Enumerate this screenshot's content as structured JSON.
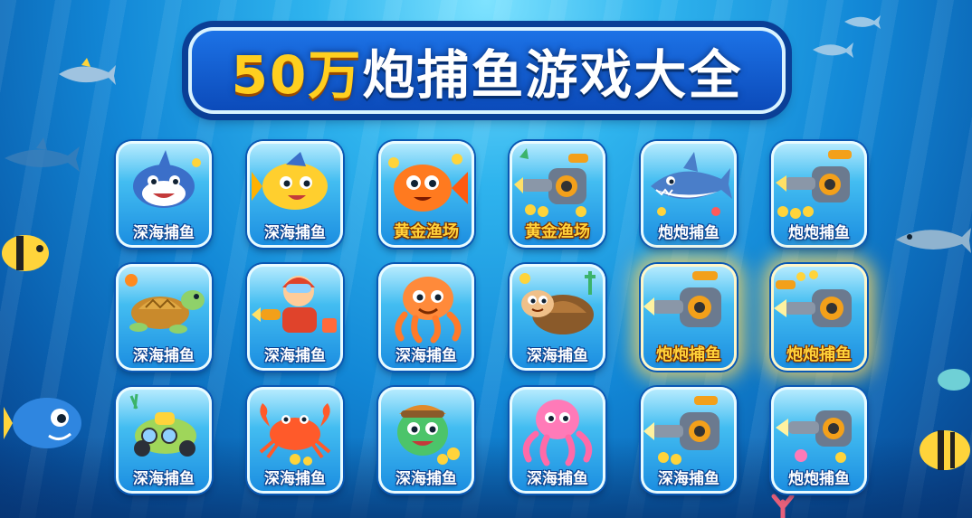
{
  "title": {
    "highlight": "50万",
    "rest": "炮捕鱼游戏大全"
  },
  "colors": {
    "title_white": "#ffffff",
    "title_gold": "#ffcf1f",
    "ocean_blue": "#1287d6"
  },
  "games": [
    {
      "label": "深海捕鱼",
      "icon": "shark-icon"
    },
    {
      "label": "深海捕鱼",
      "icon": "yellow-fish-icon"
    },
    {
      "label": "黄金渔场",
      "icon": "orange-fish-icon"
    },
    {
      "label": "黄金渔场",
      "icon": "cannon-icon"
    },
    {
      "label": "炮炮捕鱼",
      "icon": "shark-icon"
    },
    {
      "label": "炮炮捕鱼",
      "icon": "cannon-icon"
    },
    {
      "label": "深海捕鱼",
      "icon": "turtle-icon"
    },
    {
      "label": "深海捕鱼",
      "icon": "robot-icon"
    },
    {
      "label": "深海捕鱼",
      "icon": "octopus-icon"
    },
    {
      "label": "深海捕鱼",
      "icon": "turtle-icon"
    },
    {
      "label": "炮炮捕鱼",
      "icon": "cannon-icon"
    },
    {
      "label": "炮炮捕鱼",
      "icon": "cannon-icon"
    },
    {
      "label": "深海捕鱼",
      "icon": "submarine-icon"
    },
    {
      "label": "深海捕鱼",
      "icon": "crab-icon"
    },
    {
      "label": "深海捕鱼",
      "icon": "frog-icon"
    },
    {
      "label": "深海捕鱼",
      "icon": "octopus-icon"
    },
    {
      "label": "深海捕鱼",
      "icon": "cannon-icon"
    },
    {
      "label": "炮炮捕鱼",
      "icon": "cannon-icon"
    }
  ]
}
